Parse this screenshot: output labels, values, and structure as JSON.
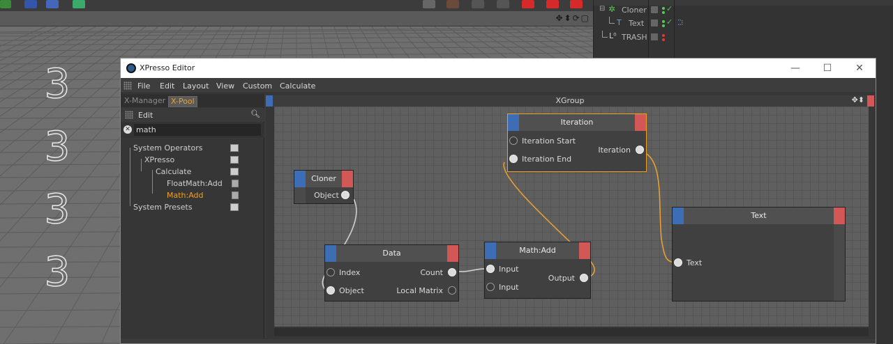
{
  "object_manager": {
    "items": [
      {
        "name": "Cloner"
      },
      {
        "name": "Text"
      },
      {
        "name": "TRASH"
      }
    ]
  },
  "viewport": {
    "clone_glyphs": [
      "3",
      "3",
      "3",
      "3"
    ]
  },
  "xpresso": {
    "window_title": "XPresso Editor",
    "menu": [
      "File",
      "Edit",
      "Layout",
      "View",
      "Custom",
      "Calculate"
    ],
    "tabs": {
      "xmanager": "X-Manager",
      "xpool": "X-Pool"
    },
    "pool": {
      "edit_label": "Edit",
      "filter_value": "math",
      "tree": [
        {
          "label": "System Operators"
        },
        {
          "label": "XPresso"
        },
        {
          "label": "Calculate"
        },
        {
          "label": "FloatMath:Add"
        },
        {
          "label": "Math:Add"
        },
        {
          "label": "System Presets"
        }
      ]
    },
    "xgroup_title": "XGroup",
    "nodes": {
      "cloner": {
        "title": "Cloner",
        "outputs": [
          "Object"
        ]
      },
      "data": {
        "title": "Data",
        "inputs": [
          "Index",
          "Object"
        ],
        "outputs": [
          "Count",
          "Local Matrix"
        ]
      },
      "mathadd": {
        "title": "Math:Add",
        "inputs": [
          "Input",
          "Input"
        ],
        "outputs": [
          "Output"
        ]
      },
      "iteration": {
        "title": "Iteration",
        "inputs": [
          "Iteration Start",
          "Iteration End"
        ],
        "outputs": [
          "Iteration"
        ]
      },
      "text": {
        "title": "Text",
        "inputs": [
          "Text"
        ]
      }
    },
    "colors": {
      "accent_orange": "#f0a020",
      "node_blue": "#3d6db5",
      "node_red": "#d25858",
      "wire_white": "#d0d0d0",
      "wire_orange": "#e8a030"
    }
  }
}
